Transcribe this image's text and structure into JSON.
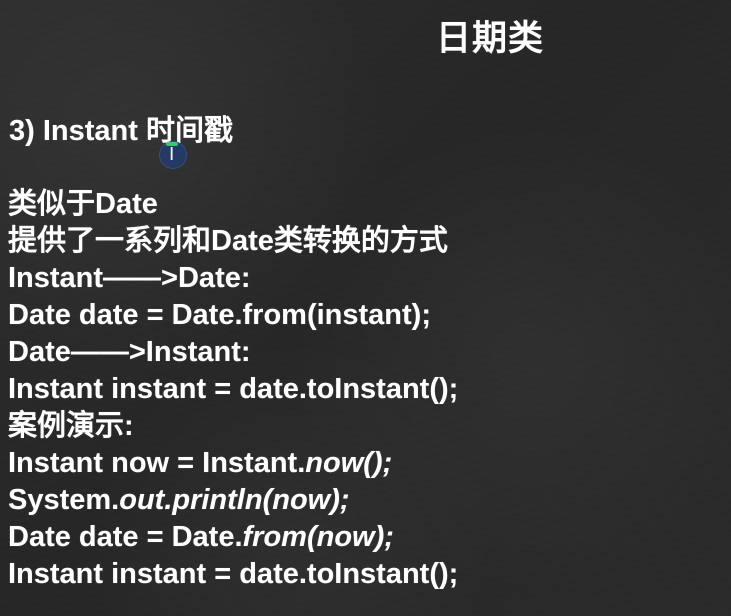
{
  "slide": {
    "title": "日期类",
    "section_heading": "3) Instant 时间戳",
    "lines": [
      {
        "parts": [
          "类似于Date"
        ]
      },
      {
        "parts": [
          "提供了一系列和Date类转换的方式"
        ]
      },
      {
        "parts": [
          "Instant——>Date:"
        ]
      },
      {
        "parts": [
          "Date  date = Date.from(instant);"
        ]
      },
      {
        "parts": [
          "Date——>Instant:"
        ]
      },
      {
        "parts": [
          "Instant instant = date.toInstant();"
        ]
      },
      {
        "parts": [
          "案例演示:"
        ]
      },
      {
        "parts": [
          "Instant now = Instant.",
          "now();"
        ]
      },
      {
        "parts": [
          "System.",
          "out.println(now);"
        ]
      },
      {
        "parts": [
          "Date date = Date.",
          "from(now);"
        ]
      },
      {
        "parts": [
          "Instant instant = date.toInstant();"
        ]
      }
    ]
  },
  "overlay": {
    "cursor_glyph": "I",
    "cursor_icon": "text-cursor-icon",
    "cursor_marker_colors": {
      "circle": "#243a66",
      "top_mark": "#38c86d"
    }
  },
  "colors": {
    "background": "#2a2b2a",
    "text": "#ffffff"
  }
}
